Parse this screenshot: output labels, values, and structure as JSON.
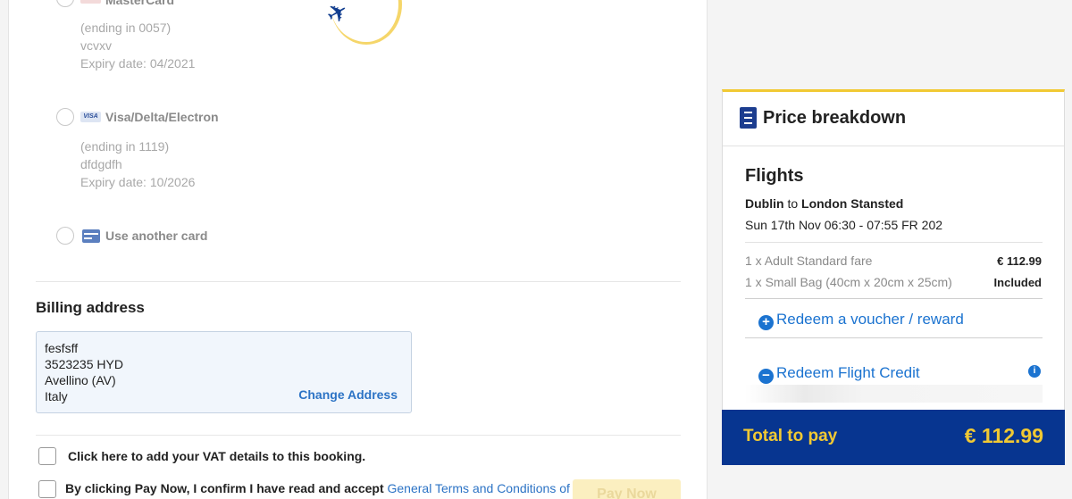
{
  "payment_methods": [
    {
      "name": "MasterCard",
      "ending": "(ending in 0057)",
      "holder": "vcvxv",
      "expiry": "Expiry date: 04/2021"
    },
    {
      "name": "Visa/Delta/Electron",
      "logo_text": "VISA",
      "ending": "(ending in 1119)",
      "holder": "dfdgdfh",
      "expiry": "Expiry date: 10/2026"
    }
  ],
  "use_another_card": "Use another card",
  "billing": {
    "title": "Billing address",
    "lines": [
      "fesfsff",
      "3523235 HYD",
      "Avellino (AV)",
      "Italy"
    ],
    "change_label": "Change Address"
  },
  "vat_label": "Click here to add your VAT details to this booking.",
  "terms": {
    "prefix": "By clicking Pay Now, I confirm I have read and accept ",
    "link": "General Terms and Conditions of"
  },
  "pay_button": "Pay Now",
  "price_breakdown": {
    "title": "Price breakdown",
    "section": "Flights",
    "origin": "Dublin",
    "to_word": "to",
    "destination": "London Stansted",
    "flight_time": "Sun 17th Nov 06:30 - 07:55 FR 202",
    "lines": [
      {
        "label": "1 x Adult Standard fare",
        "value": "€ 112.99"
      },
      {
        "label": "1 x Small Bag (40cm x 20cm x 25cm)",
        "value": "Included"
      }
    ],
    "voucher": "Redeem a voucher / reward",
    "flight_credit": "Redeem Flight Credit",
    "info_icon": "i",
    "total_label": "Total to pay",
    "total_value": "€ 112.99"
  },
  "colors": {
    "brand_blue": "#073590",
    "brand_yellow": "#f1c933",
    "link_blue": "#1b73d0"
  }
}
